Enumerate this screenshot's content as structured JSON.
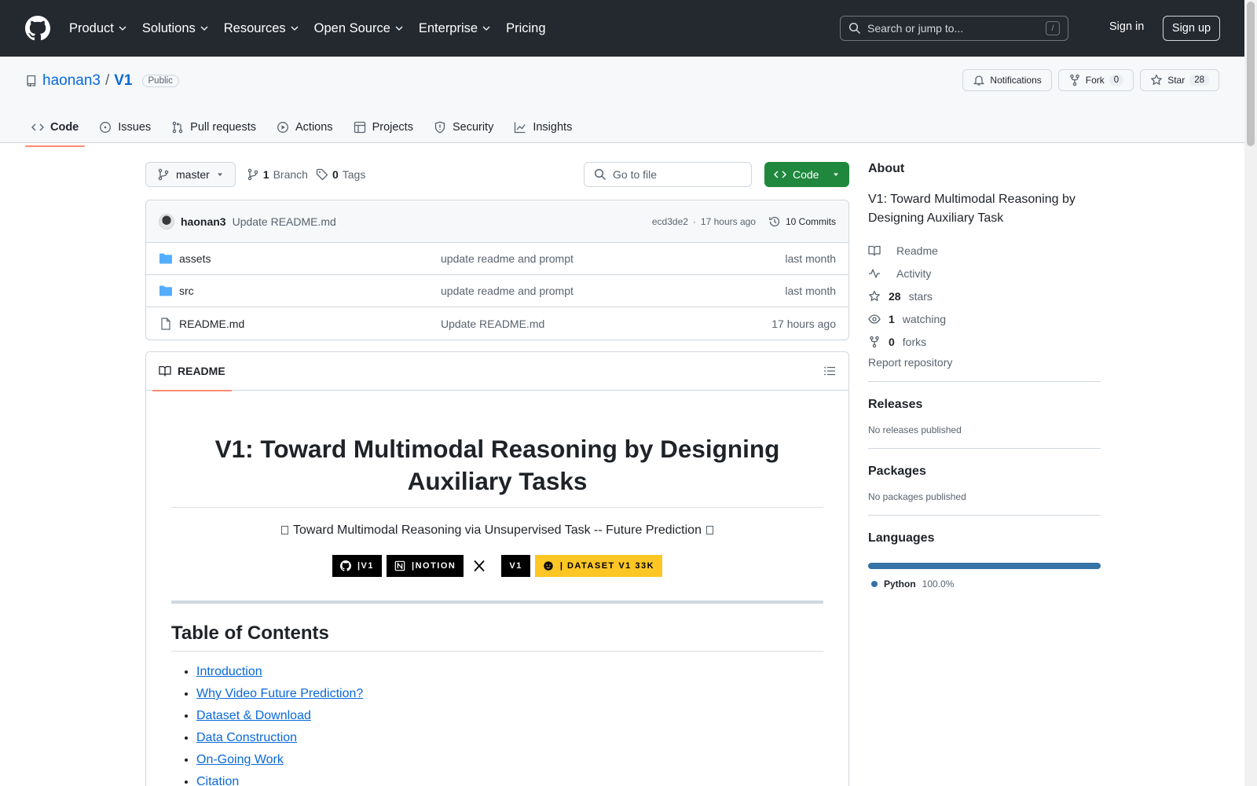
{
  "header": {
    "nav": [
      {
        "label": "Product",
        "has_menu": true
      },
      {
        "label": "Solutions",
        "has_menu": true
      },
      {
        "label": "Resources",
        "has_menu": true
      },
      {
        "label": "Open Source",
        "has_menu": true
      },
      {
        "label": "Enterprise",
        "has_menu": true
      },
      {
        "label": "Pricing",
        "has_menu": false
      }
    ],
    "search_placeholder": "Search or jump to...",
    "search_shortcut": "/",
    "signin": "Sign in",
    "signup": "Sign up"
  },
  "repo": {
    "owner": "haonan3",
    "separator": "/",
    "name": "V1",
    "visibility": "Public",
    "notifications_label": "Notifications",
    "fork_label": "Fork",
    "fork_count": "0",
    "star_label": "Star",
    "star_count": "28",
    "tabs": [
      {
        "label": "Code",
        "icon": "code-icon",
        "active": true
      },
      {
        "label": "Issues",
        "icon": "issue-icon",
        "active": false
      },
      {
        "label": "Pull requests",
        "icon": "pull-request-icon",
        "active": false
      },
      {
        "label": "Actions",
        "icon": "play-icon",
        "active": false
      },
      {
        "label": "Projects",
        "icon": "table-icon",
        "active": false
      },
      {
        "label": "Security",
        "icon": "shield-icon",
        "active": false
      },
      {
        "label": "Insights",
        "icon": "graph-icon",
        "active": false
      }
    ]
  },
  "filebar": {
    "branch": "master",
    "branch_count": "1",
    "branch_label": "Branch",
    "tag_count": "0",
    "tag_label": "Tags",
    "goto_placeholder": "Go to file",
    "code_button": "Code"
  },
  "latest_commit": {
    "author": "haonan3",
    "message": "Update README.md",
    "hash": "ecd3de2",
    "dot": "·",
    "time": "17 hours ago",
    "commits_label": "10 Commits"
  },
  "files": [
    {
      "name": "assets",
      "type": "folder",
      "commit": "update readme and prompt",
      "date": "last month"
    },
    {
      "name": "src",
      "type": "folder",
      "commit": "update readme and prompt",
      "date": "last month"
    },
    {
      "name": "README.md",
      "type": "file",
      "commit": "Update README.md",
      "date": "17 hours ago"
    }
  ],
  "readme": {
    "tab_label": "README",
    "title": "V1: Toward Multimodal Reasoning by Designing Auxiliary Tasks",
    "tagline": "Toward Multimodal Reasoning via Unsupervised Task -- Future Prediction",
    "badges": [
      {
        "text": "|V1",
        "icon": "github-icon",
        "style": "dark"
      },
      {
        "text": "|NOTION",
        "icon": "notion-icon",
        "style": "dark"
      },
      {
        "text": "",
        "icon": "x-icon",
        "style": "plain"
      },
      {
        "text": "V1",
        "icon": "",
        "style": "dark"
      },
      {
        "text": "| DATASET V1 33K",
        "icon": "huggingface-icon",
        "style": "yellow"
      }
    ],
    "toc_heading": "Table of Contents",
    "toc": [
      "Introduction",
      "Why Video Future Prediction?",
      "Dataset & Download",
      "Data Construction",
      "On-Going Work",
      "Citation"
    ]
  },
  "sidebar": {
    "about_heading": "About",
    "description": "V1: Toward Multimodal Reasoning by Designing Auxiliary Task",
    "links": [
      {
        "icon": "book-icon",
        "strong": "",
        "label": "Readme"
      },
      {
        "icon": "pulse-icon",
        "strong": "",
        "label": "Activity"
      },
      {
        "icon": "star-icon",
        "strong": "28",
        "label": "stars"
      },
      {
        "icon": "eye-icon",
        "strong": "1",
        "label": "watching"
      },
      {
        "icon": "fork-icon",
        "strong": "0",
        "label": "forks"
      }
    ],
    "report": "Report repository",
    "releases_heading": "Releases",
    "releases_text": "No releases published",
    "packages_heading": "Packages",
    "packages_text": "No packages published",
    "languages_heading": "Languages",
    "languages": [
      {
        "name": "Python",
        "percent": "100.0%",
        "color": "#3572a5"
      }
    ]
  },
  "colors": {
    "accent_green": "#1f883d",
    "tab_underline": "#fd8c73",
    "python": "#3572a5"
  }
}
